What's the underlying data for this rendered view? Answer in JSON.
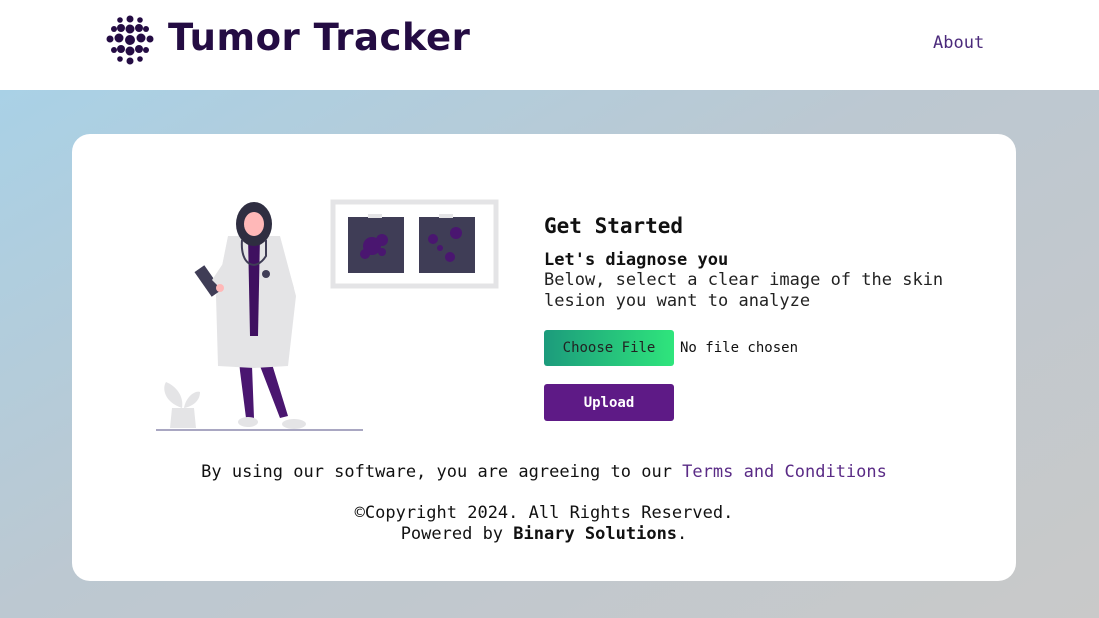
{
  "header": {
    "brand": "Tumor Tracker",
    "about_link": "About"
  },
  "form": {
    "title": "Get Started",
    "subtitle": "Let's diagnose you",
    "description": "Below, select a clear image of the skin lesion you want to analyze",
    "choose_file_label": "Choose File",
    "no_file_text": "No file chosen",
    "upload_label": "Upload"
  },
  "footer": {
    "terms_prefix": "By using our software, you are agreeing to our ",
    "terms_link": "Terms and Conditions",
    "copyright": "©Copyright 2024. All Rights Reserved.",
    "powered_prefix": "Powered by ",
    "powered_company": "Binary Solutions",
    "powered_suffix": "."
  },
  "colors": {
    "brand": "#240c43",
    "accent": "#5e1a86",
    "choose_gradient_start": "#1c9b7c",
    "choose_gradient_end": "#2fe57c"
  },
  "icons": {
    "logo": "cell-cluster-logo-icon"
  }
}
